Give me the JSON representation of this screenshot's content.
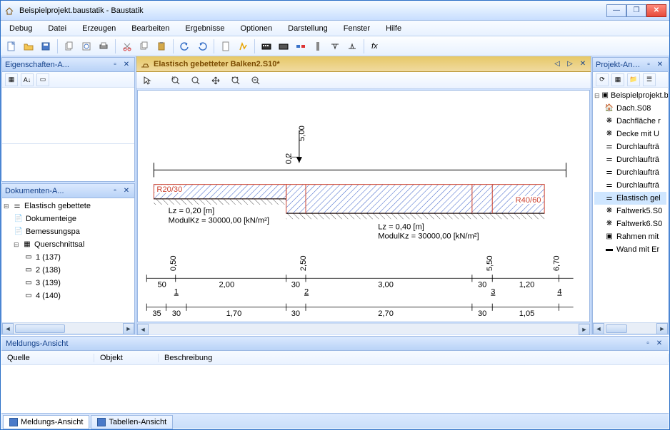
{
  "window": {
    "title": "Beispielprojekt.baustatik - Baustatik"
  },
  "menu": [
    "Debug",
    "Datei",
    "Erzeugen",
    "Bearbeiten",
    "Ergebnisse",
    "Optionen",
    "Darstellung",
    "Fenster",
    "Hilfe"
  ],
  "left": {
    "props_panel_title": "Eigenschaften-A...",
    "docs_panel_title": "Dokumenten-A...",
    "doc_root": "Elastisch gebettete",
    "doc_items": [
      "Dokumenteige",
      "Bemessungspa",
      "Querschnittsal"
    ],
    "sections": [
      "1 (137)",
      "2 (138)",
      "3 (139)",
      "4 (140)"
    ]
  },
  "doc": {
    "tab_title": "Elastisch gebetteter Balken2.S10*",
    "section1_label": "R20/30",
    "section2_label": "R40/60",
    "span1_lz": "Lz = 0,20 [m]",
    "span1_mod": "ModulKz = 30000,00 [kN/m²]",
    "span2_lz": "Lz = 0,40 [m]",
    "span2_mod": "ModulKz = 30000,00 [kN/m²]",
    "load_mag": "5,00",
    "load_dist": "0,2",
    "axis_top": {
      "ticks": [
        "0,50",
        "2,50",
        "5,50",
        "6,70"
      ],
      "segs": [
        "50",
        "2,00",
        "30",
        "3,00",
        "30",
        "1,20"
      ],
      "nodes": [
        "1",
        "2",
        "3",
        "4"
      ]
    },
    "axis_bot": {
      "segs": [
        "35",
        "30",
        "1,70",
        "30",
        "2,70",
        "30",
        "1,05"
      ]
    }
  },
  "right": {
    "panel_title": "Projekt-Ansic...",
    "root": "Beispielprojekt.b",
    "items": [
      "Dach.S08",
      "Dachfläche r",
      "Decke mit U",
      "Durchlaufträ",
      "Durchlaufträ",
      "Durchlaufträ",
      "Durchlaufträ",
      "Elastisch gel",
      "Faltwerk5.S0",
      "Faltwerk6.S0",
      "Rahmen mit",
      "Wand mit Er"
    ]
  },
  "messages": {
    "panel_title": "Meldungs-Ansicht",
    "col1": "Quelle",
    "col2": "Objekt",
    "col3": "Beschreibung",
    "tab1": "Meldungs-Ansicht",
    "tab2": "Tabellen-Ansicht"
  }
}
